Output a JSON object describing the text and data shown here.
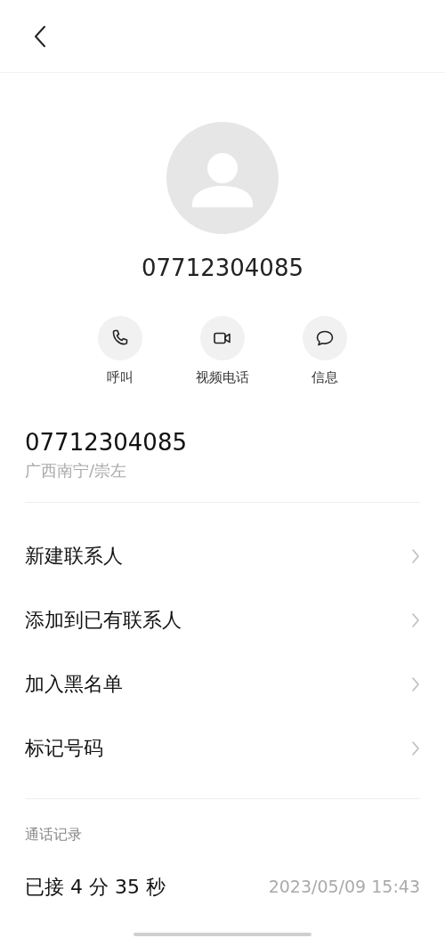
{
  "header": {
    "number": "07712304085"
  },
  "actions": [
    {
      "kind": "call",
      "label": "呼叫"
    },
    {
      "kind": "video",
      "label": "视频电话"
    },
    {
      "kind": "message",
      "label": "信息"
    }
  ],
  "number_detail": {
    "number": "07712304085",
    "location": "广西南宁/崇左"
  },
  "menu_items": [
    {
      "label": "新建联系人"
    },
    {
      "label": "添加到已有联系人"
    },
    {
      "label": "加入黑名单"
    },
    {
      "label": "标记号码"
    }
  ],
  "call_history": {
    "title": "通话记录",
    "entries": [
      {
        "status": "已接 4 分 35 秒",
        "time": "2023/05/09 15:43"
      }
    ]
  }
}
